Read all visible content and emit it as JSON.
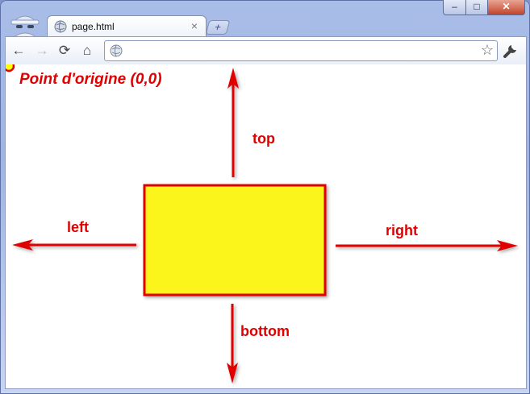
{
  "browser": {
    "tab": {
      "title": "page.html",
      "close_glyph": "×"
    },
    "new_tab_glyph": "+",
    "window_controls": {
      "minimize": "–",
      "maximize": "□",
      "close": "✕"
    },
    "nav": {
      "back": "←",
      "forward": "→",
      "reload": "⟳",
      "home": "⌂"
    },
    "address": {
      "value": "",
      "bookmark_glyph": "☆"
    },
    "icons": [
      "incognito-icon",
      "globe-icon",
      "wrench-icon",
      "star-icon"
    ]
  },
  "page": {
    "origin_label": "Point d'origine (0,0)",
    "labels": {
      "top": "top",
      "left": "left",
      "right": "right",
      "bottom": "bottom"
    },
    "colors": {
      "arrow": "#e00000",
      "box_fill": "#fbf51e",
      "box_border": "#e00000",
      "origin_fill": "#ffff00"
    }
  }
}
